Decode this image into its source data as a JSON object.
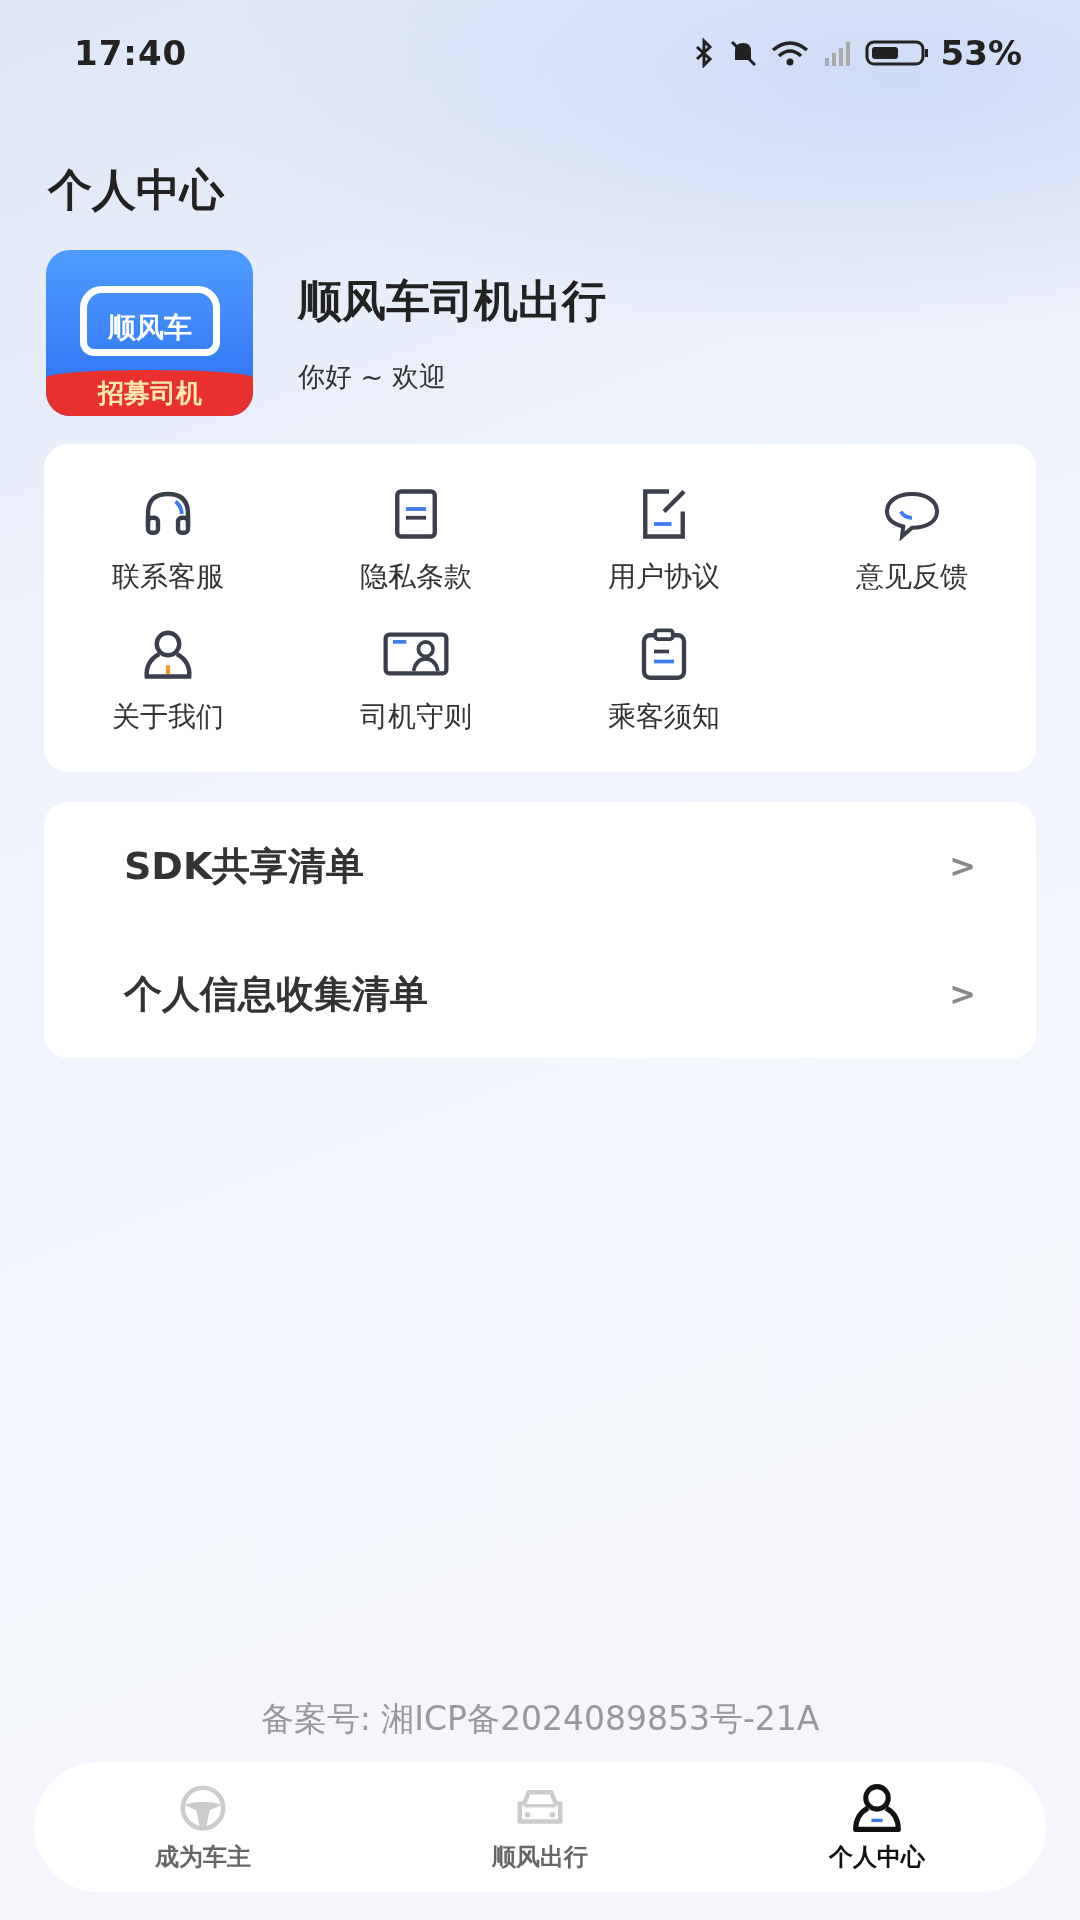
{
  "status_bar": {
    "time": "17:40",
    "battery": "53%"
  },
  "page_title": "个人中心",
  "profile": {
    "logo_text": "顺风车",
    "logo_banner": "招募司机",
    "name": "顺风车司机出行",
    "greeting": "你好 ~ 欢迎"
  },
  "menu_grid": [
    {
      "label": "联系客服"
    },
    {
      "label": "隐私条款"
    },
    {
      "label": "用户协议"
    },
    {
      "label": "意见反馈"
    },
    {
      "label": "关于我们"
    },
    {
      "label": "司机守则"
    },
    {
      "label": "乘客须知"
    }
  ],
  "list": [
    {
      "label": "SDK共享清单",
      "chevron": ">"
    },
    {
      "label": "个人信息收集清单",
      "chevron": ">"
    }
  ],
  "footer": "备案号: 湘ICP备2024089853号-21A",
  "tabs": [
    {
      "label": "成为车主",
      "selected": false
    },
    {
      "label": "顺风出行",
      "selected": false
    },
    {
      "label": "个人中心",
      "selected": true
    }
  ]
}
